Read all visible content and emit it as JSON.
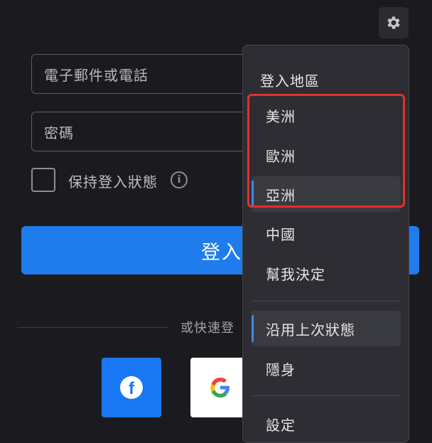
{
  "form": {
    "email_placeholder": "電子郵件或電話",
    "password_placeholder": "密碼",
    "remember_label": "保持登入狀態",
    "info_glyph": "i",
    "login_button": "登入",
    "quick_login_text": "或快速登"
  },
  "social": {
    "facebook_glyph": "f",
    "google_glyph": "G",
    "facebook_color": "#1877f2",
    "google_colors": [
      "#4285f4",
      "#ea4335",
      "#fbbc05",
      "#34a853"
    ]
  },
  "menu": {
    "header": "登入地區",
    "regions": [
      "美洲",
      "歐洲",
      "亞洲"
    ],
    "selected_region": "亞洲",
    "other_regions": [
      "中國",
      "幫我決定"
    ],
    "status_items": [
      "沿用上次狀態",
      "隱身"
    ],
    "settings": "設定"
  },
  "colors": {
    "accent": "#1f7cec",
    "highlight_box": "#e3302c"
  }
}
